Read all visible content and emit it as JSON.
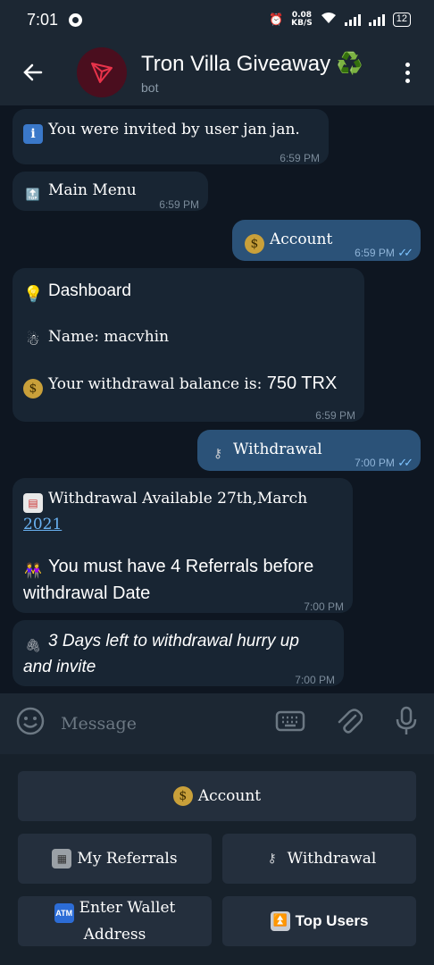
{
  "status_bar": {
    "time": "7:01",
    "net_speed": "0.08",
    "net_unit": "KB/S",
    "battery": "12"
  },
  "header": {
    "title": "Tron Villa Giveaway ♻️",
    "subtitle": "bot"
  },
  "messages": [
    {
      "id": "m1",
      "text": "You were invited by user jan jan.",
      "time": "6:59 PM",
      "icon": "info-icon"
    },
    {
      "id": "m2",
      "text": "Main Menu",
      "time": "6:59 PM",
      "icon": "top-arrow-icon"
    },
    {
      "id": "m3",
      "text": "Account",
      "time": "6:59 PM",
      "icon": "money-bag-icon"
    },
    {
      "id": "m4",
      "title": "Dashboard",
      "name_label": "Name: macvhin",
      "balance_label": "Your withdrawal balance is:",
      "balance_value": "750 TRX",
      "time": "6:59 PM"
    },
    {
      "id": "m5",
      "text": "Withdrawal",
      "time": "7:00 PM",
      "icon": "key-icon"
    },
    {
      "id": "m6",
      "text_prefix": "Withdrawal Available 27th,March",
      "date_link": "2021",
      "referral_text": "You must have 4 Referrals before withdrawal Date",
      "time": "7:00 PM"
    },
    {
      "id": "m7",
      "text": "3 Days left to withdrawal hurry up and invite",
      "time": "7:00 PM"
    }
  ],
  "composer": {
    "placeholder": "Message"
  },
  "keyboard": {
    "account": "Account",
    "my_referrals": "My Referrals",
    "withdrawal": "Withdrawal",
    "enter_wallet": "Enter Wallet Address",
    "top_users": "Top Users"
  },
  "colors": {
    "background": "#0e1621",
    "incoming_bubble": "#182533",
    "outgoing_bubble": "#2b5278",
    "header": "#1c2733",
    "link": "#6ab3f3"
  }
}
